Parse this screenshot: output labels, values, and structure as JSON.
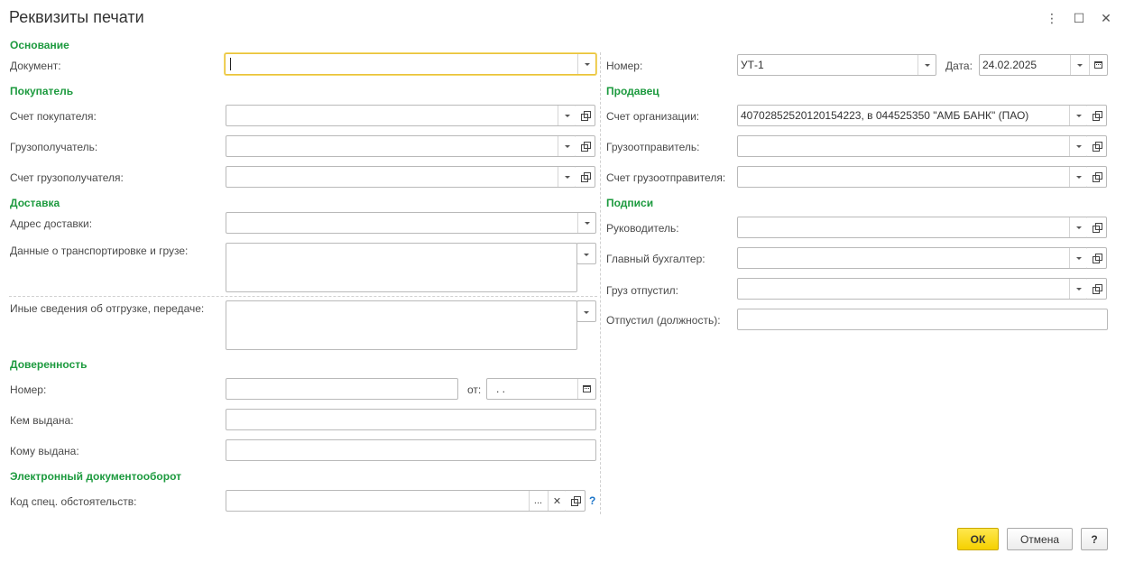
{
  "window": {
    "title": "Реквизиты печати",
    "more_icon": "⋮",
    "maximize_icon": "☐",
    "close_icon": "✕"
  },
  "left": {
    "basis": {
      "section": "Основание",
      "document_label": "Документ:",
      "document_value": ""
    },
    "buyer": {
      "section": "Покупатель",
      "account_label": "Счет покупателя:",
      "consignee_label": "Грузополучатель:",
      "consignee_account_label": "Счет грузополучателя:"
    },
    "delivery": {
      "section": "Доставка",
      "address_label": "Адрес доставки:",
      "transport_label": "Данные о транспортировке и грузе:",
      "other_label": "Иные сведения об отгрузке, передаче:"
    },
    "proxy": {
      "section": "Доверенность",
      "number_label": "Номер:",
      "from_label": "от:",
      "date_value": " .  .",
      "issued_by_label": "Кем выдана:",
      "issued_to_label": "Кому выдана:"
    },
    "edo": {
      "section": "Электронный документооборот",
      "code_label": "Код спец. обстоятельств:",
      "help": "?"
    }
  },
  "right": {
    "number_label": "Номер:",
    "number_value": "УТ-1",
    "date_label": "Дата:",
    "date_value": "24.02.2025",
    "seller": {
      "section": "Продавец",
      "org_account_label": "Счет организации:",
      "org_account_value": "40702852520120154223, в 044525350 \"АМБ БАНК\" (ПАО)",
      "shipper_label": "Грузоотправитель:",
      "shipper_account_label": "Счет грузоотправителя:"
    },
    "signatures": {
      "section": "Подписи",
      "director_label": "Руководитель:",
      "chief_accountant_label": "Главный бухгалтер:",
      "cargo_released_label": "Груз отпустил:",
      "released_position_label": "Отпустил (должность):"
    }
  },
  "footer": {
    "ok_label": "ОК",
    "cancel_label": "Отмена",
    "help_label": "?"
  },
  "colors": {
    "section": "#1c9a3e",
    "ok_button": "#f5d000",
    "focus_border": "#e9c23b"
  }
}
